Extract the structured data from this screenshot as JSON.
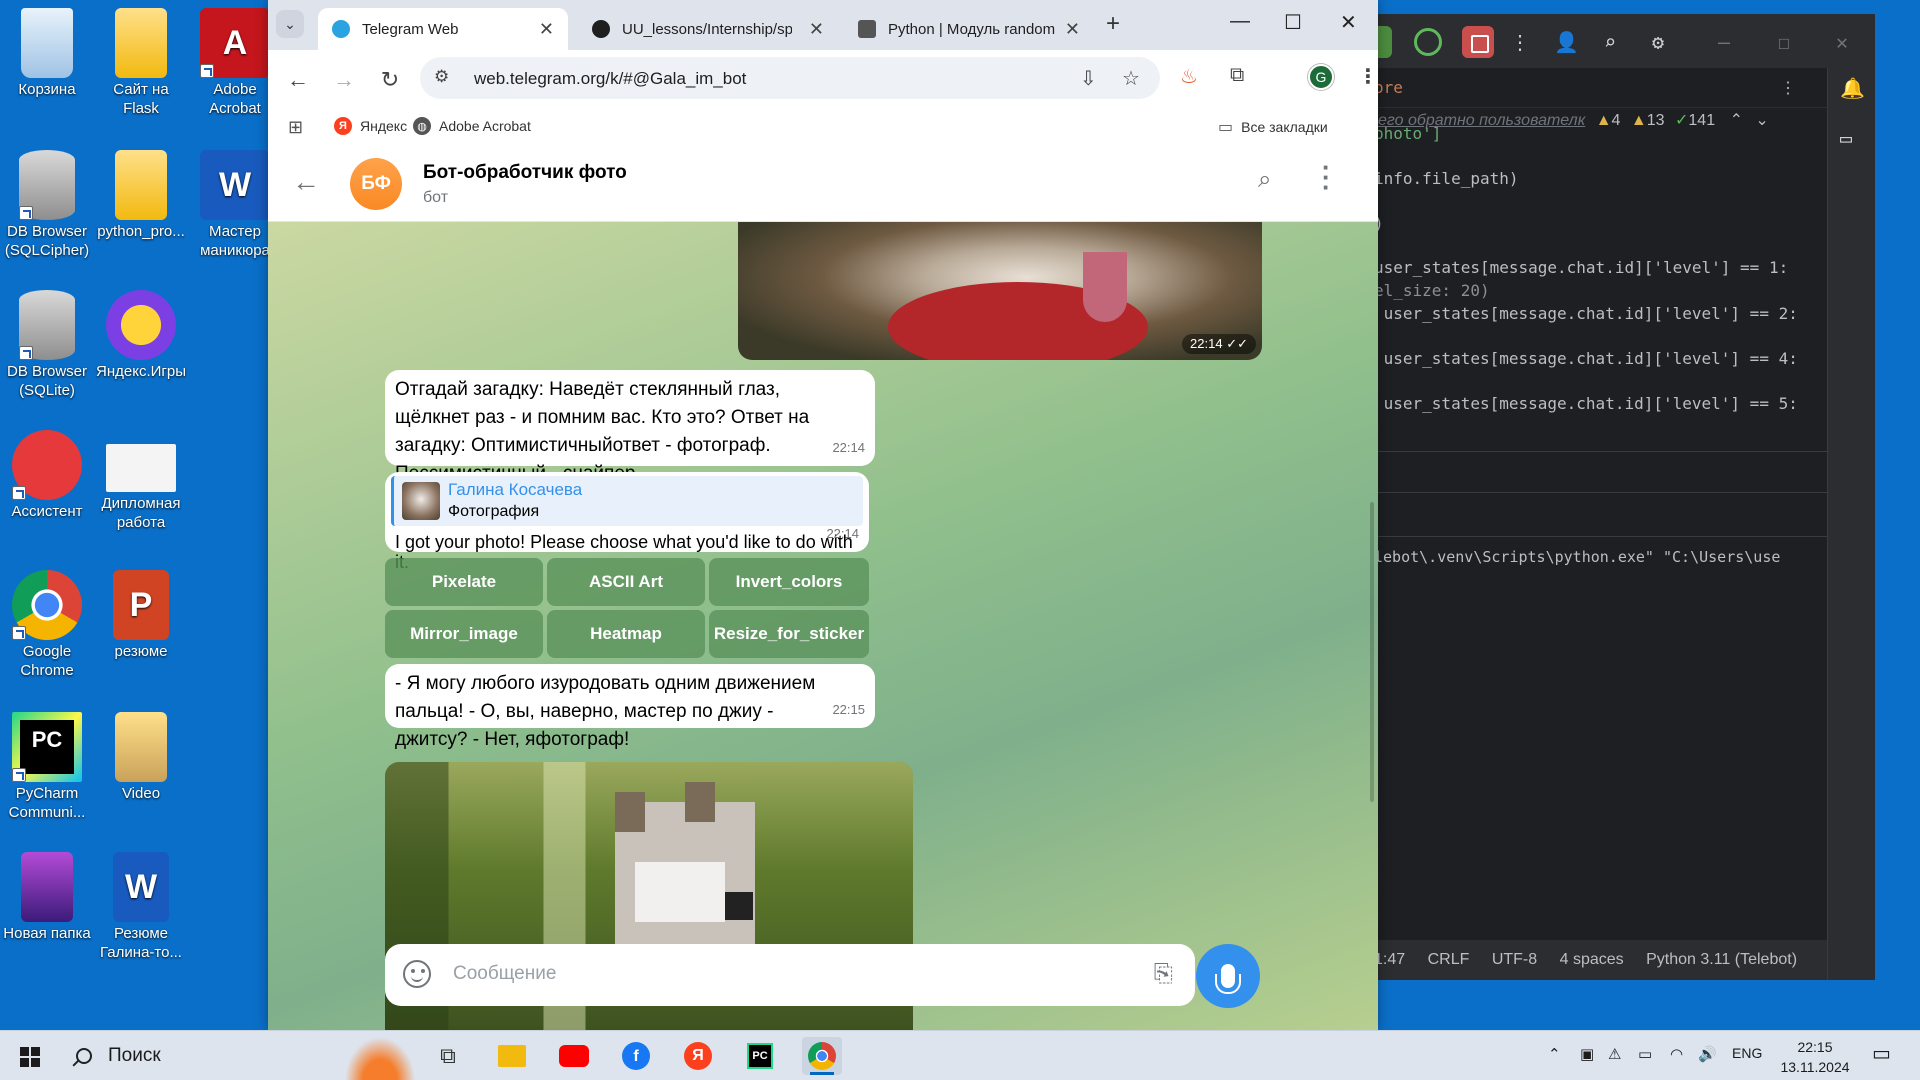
{
  "desktop": {
    "icons": [
      {
        "label": "Корзина"
      },
      {
        "label": "Сайт на Flask"
      },
      {
        "label": "Adobe Acrobat"
      },
      {
        "label": "DB Browser (SQLCipher)"
      },
      {
        "label": "python_pro..."
      },
      {
        "label": "Мастер маникюра"
      },
      {
        "label": "DB Browser (SQLite)"
      },
      {
        "label": "Яндекс.Игры"
      },
      {
        "label": "Ассистент"
      },
      {
        "label": "Дипломная работа"
      },
      {
        "label": "Google Chrome"
      },
      {
        "label": "резюме"
      },
      {
        "label": "PyCharm Communi..."
      },
      {
        "label": "Video"
      },
      {
        "label": "Новая папка"
      },
      {
        "label": "Резюме Галина-то..."
      }
    ]
  },
  "ide": {
    "tab_fragment": "ore",
    "inspection": "его обратно пользователк",
    "warn1": "4",
    "warn2": "13",
    "ok": "141",
    "lines": [
      "photo']",
      "info.file_path)",
      ")",
      "user_states[message.chat.id]['level'] == 1:",
      "el_size: 20)",
      " user_states[message.chat.id]['level'] == 2:",
      " user_states[message.chat.id]['level'] == 4:",
      " user_states[message.chat.id]['level'] == 5:",
      "lebot\\.venv\\Scripts\\python.exe\" \"C:\\Users\\use"
    ],
    "status": {
      "pos": "1:47",
      "eol": "CRLF",
      "enc": "UTF-8",
      "indent": "4 spaces",
      "interp": "Python 3.11 (Telebot)"
    }
  },
  "browser": {
    "tabs": [
      {
        "label": "Telegram Web",
        "color": "#2aa3e0"
      },
      {
        "label": "UU_lessons/Internship/sp",
        "color": "#1f1f1f"
      },
      {
        "label": "Python | Модуль random",
        "color": "#555555"
      }
    ],
    "url": "web.telegram.org/k/#@Gala_im_bot",
    "profile_initial": "G",
    "bookmarks": [
      {
        "label": "Яндекс",
        "color": "#fc3f1d"
      },
      {
        "label": "Adobe Acrobat",
        "color": "#555555"
      }
    ],
    "all_bookmarks": "Все закладки"
  },
  "telegram": {
    "chat_initials": "БФ",
    "chat_title": "Бот-обработчик фото",
    "chat_subtitle": "бот",
    "messages": [
      {
        "time": "22:14"
      },
      {
        "text": "Отгадай загадку: Наведёт стеклянный глаз, щёлкнет раз - и помним вас. Кто это? Ответ на загадку: Оптимистичныйответ - фотограф. Пессимистичный - снайпер",
        "time": "22:14"
      },
      {
        "reply_name": "Галина Косачева",
        "reply_text": "Фотография",
        "text": "I got your photo! Please choose what you'd like to do with it.",
        "time": "22:14"
      },
      {
        "text": "- Я могу любого изуродовать одним движением пальца! - О, вы, наверно, мастер по джиу - джитсу? - Нет, яфотограф!",
        "time": "22:15"
      }
    ],
    "keyboard": [
      "Pixelate",
      "ASCII Art",
      "Invert_colors",
      "Mirror_image",
      "Heatmap",
      "Resize_for_sticker"
    ],
    "composer_placeholder": "Сообщение"
  },
  "taskbar": {
    "search": "Поиск",
    "lang": "ENG",
    "time": "22:15",
    "date": "13.11.2024"
  }
}
